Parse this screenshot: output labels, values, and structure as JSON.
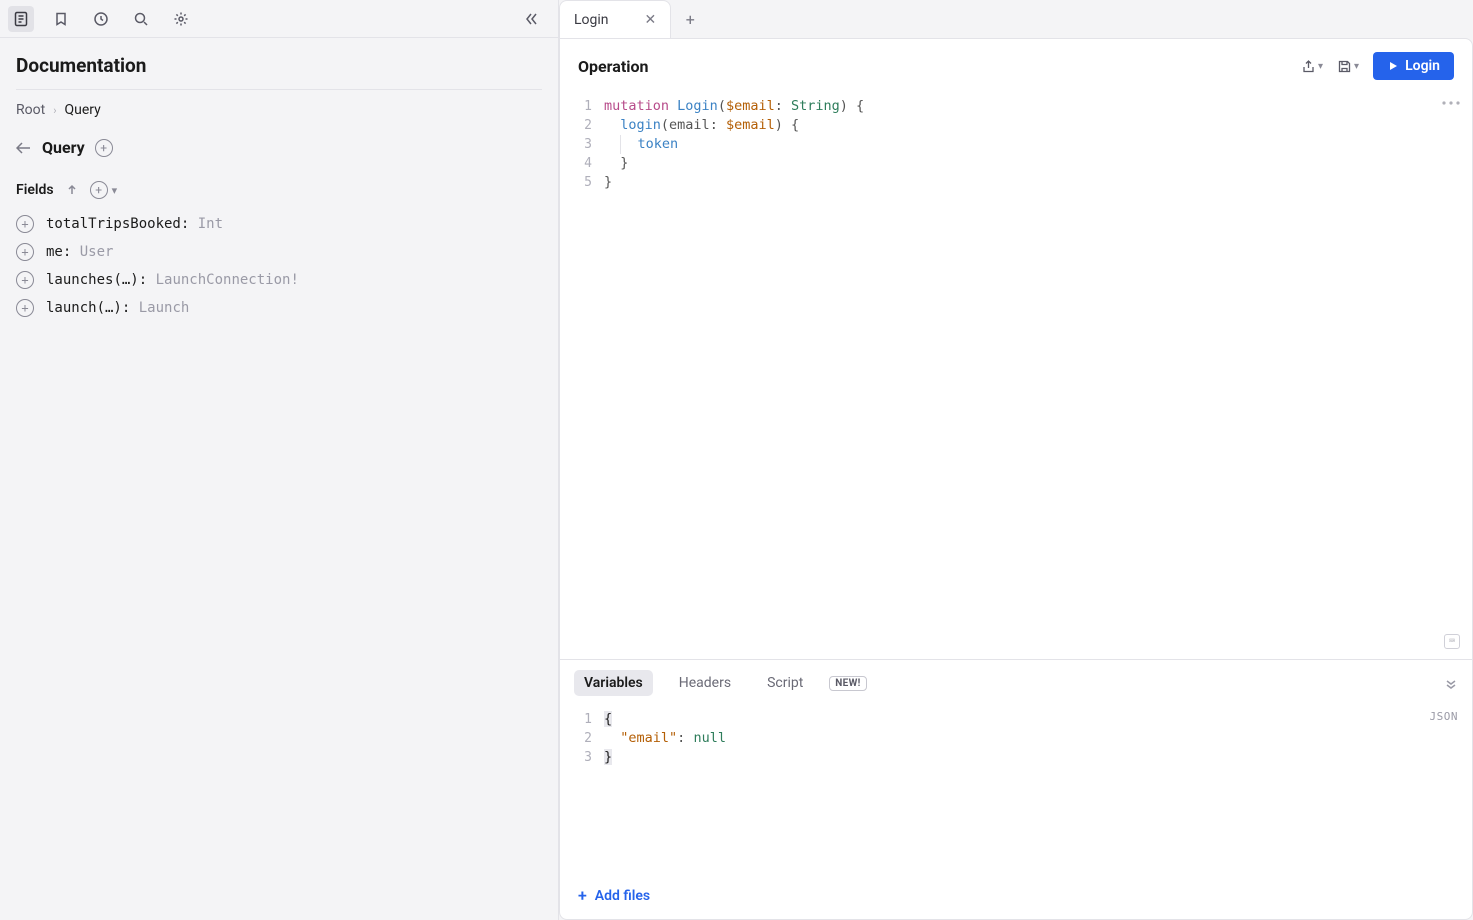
{
  "sidebar": {
    "title": "Documentation",
    "breadcrumbs": {
      "root": "Root",
      "current": "Query"
    },
    "header": {
      "label": "Query"
    },
    "fieldsLabel": "Fields",
    "fields": [
      {
        "name": "totalTripsBooked",
        "sig": ":",
        "type": "Int"
      },
      {
        "name": "me",
        "sig": ":",
        "type": "User"
      },
      {
        "name": "launches",
        "sig": "(…):",
        "type": "LaunchConnection!"
      },
      {
        "name": "launch",
        "sig": "(…):",
        "type": "Launch"
      }
    ]
  },
  "tabs": {
    "active": "Login"
  },
  "operation": {
    "title": "Operation",
    "runLabel": "Login",
    "lines": [
      "1",
      "2",
      "3",
      "4",
      "5"
    ],
    "code": {
      "l1": {
        "kw": "mutation",
        "name": "Login",
        "var": "$email",
        "type": "String"
      },
      "l2": {
        "fn": "login",
        "arg": "email",
        "var": "$email"
      },
      "l3": {
        "field": "token"
      }
    }
  },
  "bottom": {
    "tabs": {
      "variables": "Variables",
      "headers": "Headers",
      "script": "Script",
      "badge": "NEW!"
    },
    "jsonBadge": "JSON",
    "lines": [
      "1",
      "2",
      "3"
    ],
    "vars": {
      "key": "\"email\"",
      "val": "null"
    },
    "addFiles": "Add files"
  }
}
